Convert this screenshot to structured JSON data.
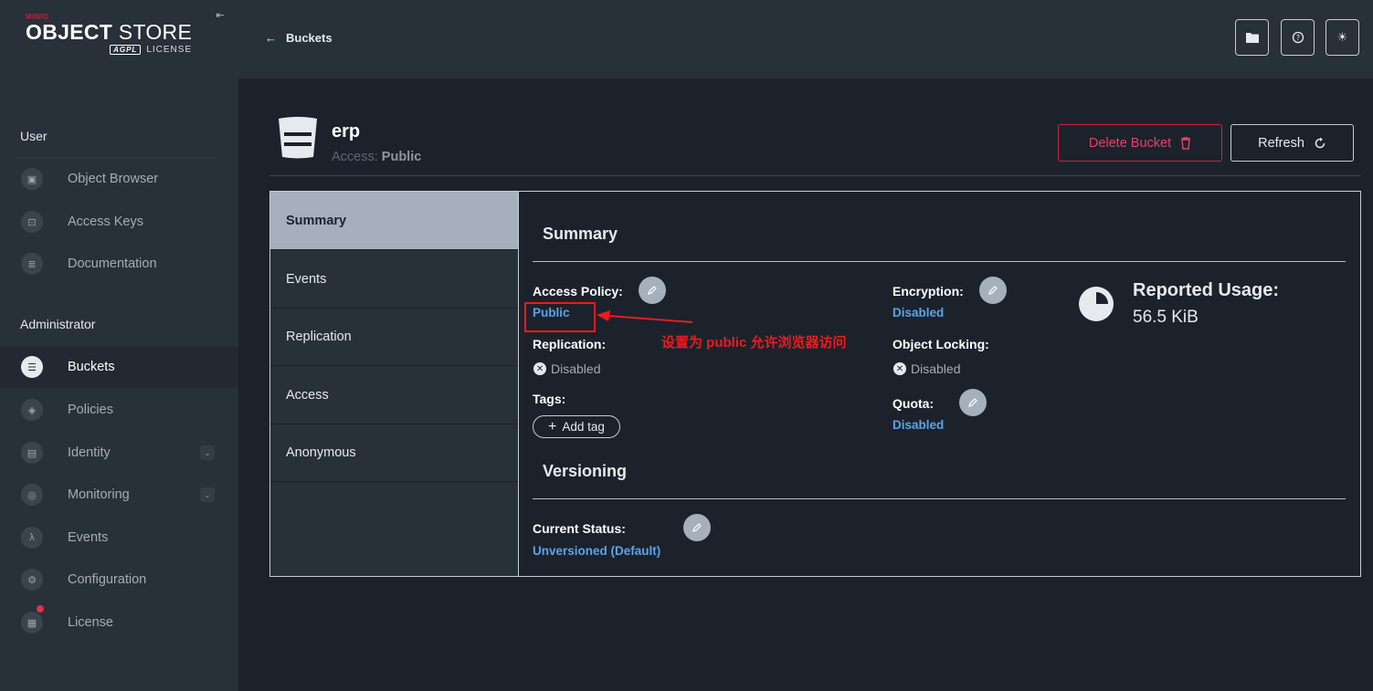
{
  "app": {
    "brand_small": "MINIO",
    "brand_main_bold": "OBJECT",
    "brand_main_light": "STORE",
    "license_badge": "AGPL",
    "license_label": "LICENSE"
  },
  "sidebar": {
    "user_section": "User",
    "user_items": [
      {
        "label": "Object Browser",
        "icon": "object-browser-icon"
      },
      {
        "label": "Access Keys",
        "icon": "access-keys-icon"
      },
      {
        "label": "Documentation",
        "icon": "documentation-icon"
      }
    ],
    "admin_section": "Administrator",
    "admin_items": [
      {
        "label": "Buckets",
        "icon": "bucket-icon",
        "active": true
      },
      {
        "label": "Policies",
        "icon": "policy-shield-icon"
      },
      {
        "label": "Identity",
        "icon": "identity-icon",
        "expandable": true
      },
      {
        "label": "Monitoring",
        "icon": "monitoring-icon",
        "expandable": true
      },
      {
        "label": "Events",
        "icon": "lambda-icon"
      },
      {
        "label": "Configuration",
        "icon": "gear-icon"
      },
      {
        "label": "License",
        "icon": "license-icon"
      }
    ]
  },
  "topbar": {
    "back_label": "Buckets"
  },
  "bucket": {
    "name": "erp",
    "access_prefix": "Access:",
    "access_value": "Public",
    "delete_label": "Delete Bucket",
    "refresh_label": "Refresh"
  },
  "tabs": [
    "Summary",
    "Events",
    "Replication",
    "Access",
    "Anonymous"
  ],
  "summary": {
    "title": "Summary",
    "access_policy_label": "Access Policy:",
    "access_policy_value": "Public",
    "replication_label": "Replication:",
    "replication_value": "Disabled",
    "tags_label": "Tags:",
    "add_tag_label": "Add tag",
    "encryption_label": "Encryption:",
    "encryption_value": "Disabled",
    "object_locking_label": "Object Locking:",
    "object_locking_value": "Disabled",
    "quota_label": "Quota:",
    "quota_value": "Disabled",
    "usage_label": "Reported Usage:",
    "usage_value": "56.5 KiB"
  },
  "versioning": {
    "title": "Versioning",
    "status_label": "Current Status:",
    "status_value": "Unversioned (Default)"
  },
  "annotation": {
    "text": "设置为 public 允许浏览器访问"
  },
  "colors": {
    "accent_link": "#5ba3ea",
    "danger": "#c8243f",
    "annotation": "#ea1c1c"
  }
}
